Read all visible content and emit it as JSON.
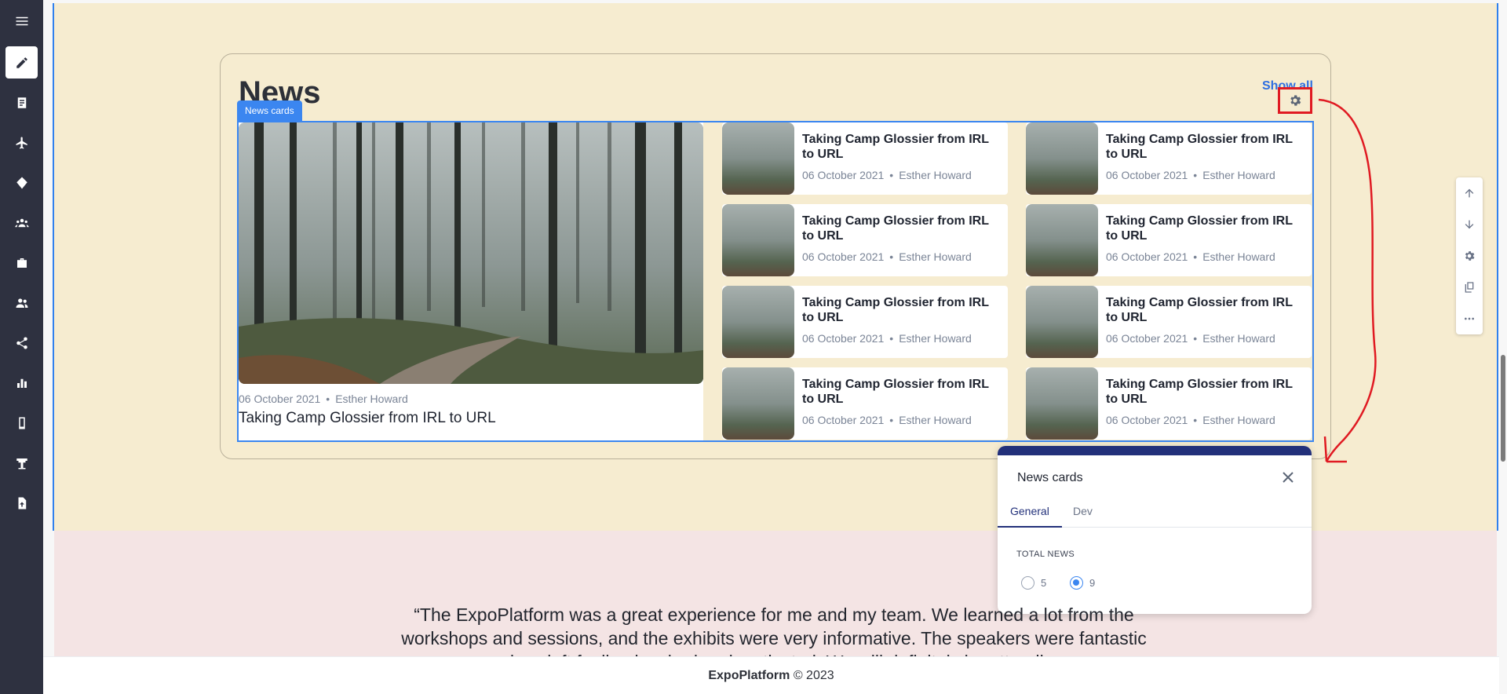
{
  "sidebar": {
    "items": [
      {
        "icon": "menu-icon"
      },
      {
        "icon": "pencil-icon",
        "active": true
      },
      {
        "icon": "document-icon"
      },
      {
        "icon": "airplane-icon"
      },
      {
        "icon": "diamond-icon"
      },
      {
        "icon": "group-icon"
      },
      {
        "icon": "briefcase-icon"
      },
      {
        "icon": "users-icon"
      },
      {
        "icon": "share-icon"
      },
      {
        "icon": "bar-chart-icon"
      },
      {
        "icon": "mobile-icon"
      },
      {
        "icon": "booth-icon"
      },
      {
        "icon": "upload-file-icon"
      }
    ]
  },
  "news": {
    "title": "News",
    "show_all": "Show all",
    "block_label": "News cards",
    "featured": {
      "date": "06 October 2021",
      "author": "Esther Howard",
      "separator": "•",
      "title": "Taking Camp Glossier from IRL to URL"
    },
    "cards": [
      {
        "title": "Taking Camp Glossier from IRL to URL",
        "date": "06 October 2021",
        "author": "Esther Howard"
      },
      {
        "title": "Taking Camp Glossier from IRL to URL",
        "date": "06 October 2021",
        "author": "Esther Howard"
      },
      {
        "title": "Taking Camp Glossier from IRL to URL",
        "date": "06 October 2021",
        "author": "Esther Howard"
      },
      {
        "title": "Taking Camp Glossier from IRL to URL",
        "date": "06 October 2021",
        "author": "Esther Howard"
      },
      {
        "title": "Taking Camp Glossier from IRL to URL",
        "date": "06 October 2021",
        "author": "Esther Howard"
      },
      {
        "title": "Taking Camp Glossier from IRL to URL",
        "date": "06 October 2021",
        "author": "Esther Howard"
      },
      {
        "title": "Taking Camp Glossier from IRL to URL",
        "date": "06 October 2021",
        "author": "Esther Howard"
      },
      {
        "title": "Taking Camp Glossier from IRL to URL",
        "date": "06 October 2021",
        "author": "Esther Howard"
      }
    ]
  },
  "popup": {
    "title": "News cards",
    "tabs": [
      "General",
      "Dev"
    ],
    "active_tab": "General",
    "field_label": "TOTAL NEWS",
    "options": [
      "5",
      "9"
    ],
    "selected": "9"
  },
  "quote": {
    "text": "“The ExpoPlatform was a great experience for me and my team. We learned a lot from the workshops and sessions, and the exhibits were very informative. The speakers were fantastic and we left feeling inspired and motivated. We will definitely be attending"
  },
  "footer": {
    "brand": "ExpoPlatform",
    "copyright": "© 2023"
  },
  "colors": {
    "sidebar_bg": "#2e3140",
    "news_section_bg": "#f6ecd0",
    "quote_section_bg": "#f4e4e4",
    "selection_blue": "#3b86f0",
    "popup_accent": "#22307a",
    "annotation_red": "#e01a22"
  }
}
